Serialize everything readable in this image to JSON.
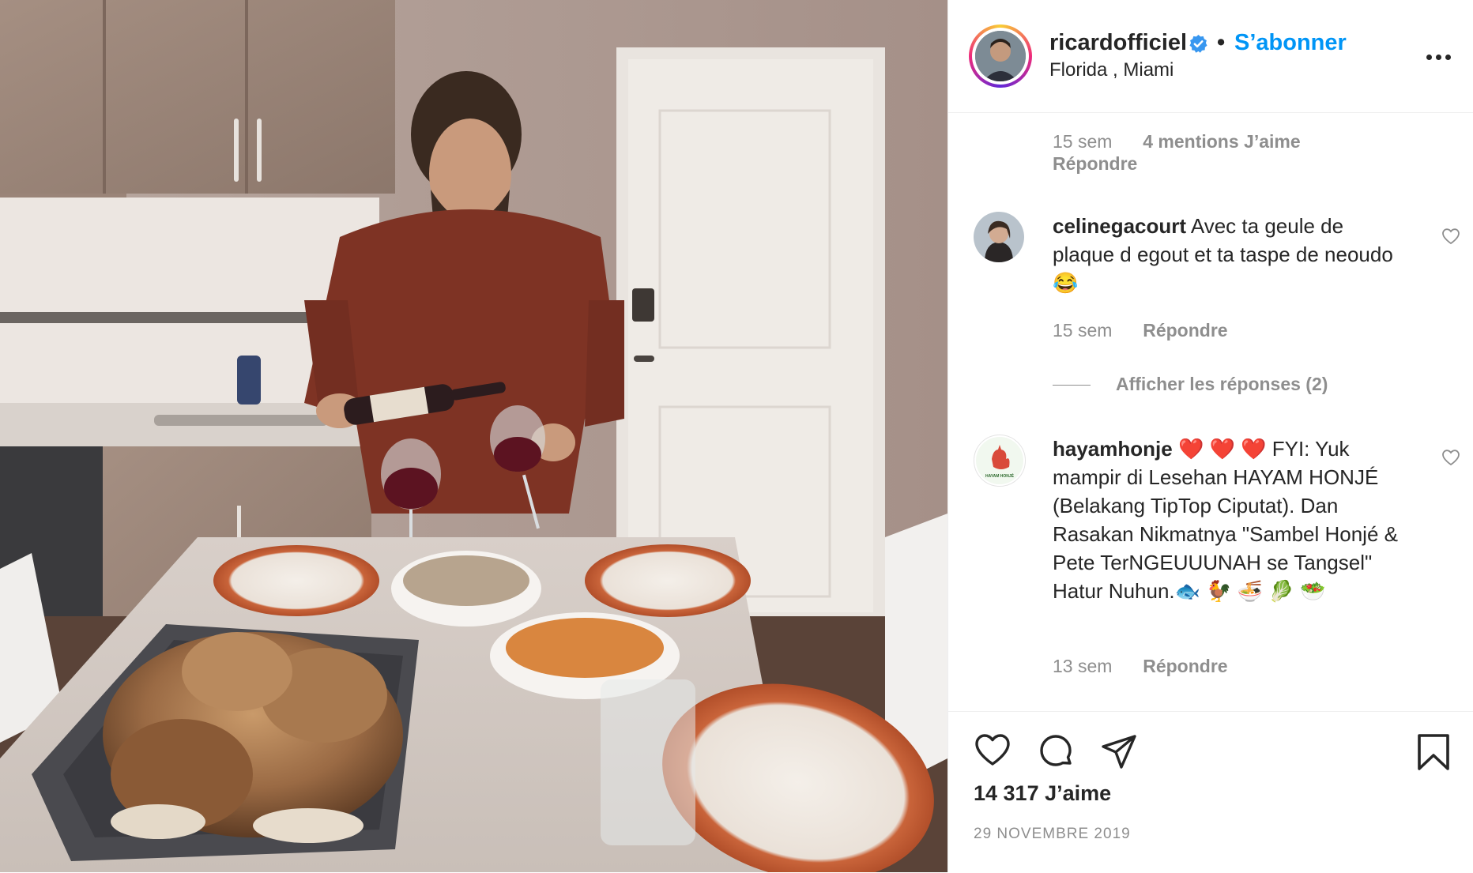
{
  "post": {
    "photo_alt": "Man pouring red wine at a dinner table with roast turkey",
    "author": {
      "username": "ricardofficiel",
      "verified_icon": "verified-badge-icon",
      "separator": "•",
      "follow_label": "S’abonner",
      "location": "Florida , Miami",
      "more_icon": "more-options-icon"
    },
    "comments": [
      {
        "time": "15 sem",
        "likes_label": "4 mentions J’aime",
        "reply_label": "Répondre"
      },
      {
        "username": "celinegacourt",
        "text": " Avec ta geule de plaque d egout et ta taspe de neoudo😂",
        "time": "15 sem",
        "reply_label": "Répondre",
        "view_replies_label": "Afficher les réponses (2)"
      },
      {
        "username": "hayamhonje",
        "text": " ❤️ ❤️ ❤️  FYI: Yuk mampir di Lesehan HAYAM HONJÉ (Belakang TipTop Ciputat). Dan Rasakan Nikmatnya \"Sambel Honjé & Pete TerNGEUUUNAH se Tangsel\" Hatur Nuhun.🐟 🐓 🍜 🥬 🥗",
        "time": "13 sem",
        "reply_label": "Répondre",
        "avatar_caption": "HAYAM HONJÉ"
      }
    ],
    "actions": {
      "like_icon": "heart-icon",
      "comment_icon": "comment-icon",
      "share_icon": "paper-plane-icon",
      "save_icon": "bookmark-icon"
    },
    "likes_count": "14 317 J’aime",
    "date": "29 NOVEMBRE 2019",
    "colors": {
      "accent": "#0095f6",
      "text": "#262626",
      "muted": "#8e8e8e",
      "divider": "#efefef",
      "verified": "#3897f0"
    }
  }
}
